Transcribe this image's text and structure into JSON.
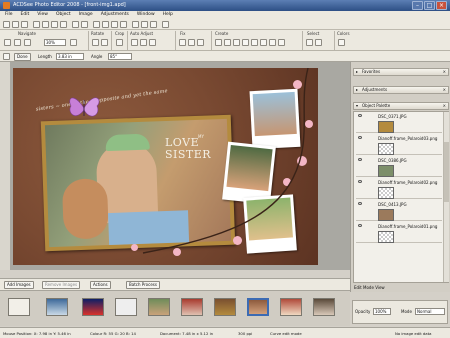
{
  "window": {
    "title": "ACDSee Photo Editor 2008 - [front-img1.apd]",
    "minimize": "–",
    "maximize": "□",
    "close": "×"
  },
  "menu": [
    "File",
    "Edit",
    "View",
    "Object",
    "Image",
    "Adjustments",
    "Window",
    "Help"
  ],
  "groups": {
    "navigate": "Navigate",
    "zoom": "30%",
    "rotate": "Rotate",
    "crop": "Crop",
    "auto_adjust": "Auto Adjust",
    "fix": "Fix",
    "create": "Create",
    "select": "Select",
    "colors": "Colors"
  },
  "options": {
    "done": "Done",
    "length_label": "Length",
    "length_value": "3.83 in",
    "angle_label": "Angle",
    "angle_value": "85°"
  },
  "artwork": {
    "curved_text": "sisters ~ one of the ~ opposite and yet the same",
    "love_title": "LOVE",
    "love_sub": "MY",
    "sister_title": "SISTER"
  },
  "panels": {
    "favorites": "Favorites",
    "adjustments": "Adjustments",
    "object_palette": "Object Palette",
    "layers": [
      {
        "name": "DSC_0371.JPG",
        "thumb": "photo"
      },
      {
        "name": "Dianoff.frame_Polaroid03.png",
        "thumb": "checker"
      },
      {
        "name": "DSC_0386.JPG",
        "thumb": "photo"
      },
      {
        "name": "Dianoff.frame_Polaroid02.png",
        "thumb": "checker"
      },
      {
        "name": "DSC_0413.JPG",
        "thumb": "photo"
      },
      {
        "name": "Dianoff.frame_Polaroid01.png",
        "thumb": "checker"
      }
    ],
    "edit_mode": "Edit Mode View",
    "opacity_label": "Opacity",
    "opacity_value": "100%",
    "mode_label": "Mode",
    "mode_value": "Normal"
  },
  "bottom": {
    "add_images": "Add Images",
    "remove_images": "Remove Images",
    "actions": "Actions",
    "batch_process": "Batch Process"
  },
  "status": {
    "mouse": "Mouse Position:  X: 7.98 in  Y: 5.46 in",
    "colour": "Colour  R: 55  G: 20  B: 14",
    "document": "Document: 7.48 in x 5.12 in",
    "dpi": "300 ppi",
    "mode": "Curve edit mode",
    "edit_info": "No image edit data"
  },
  "colors": {
    "canvas_bg": "#a9a8a2",
    "art_bg": "#7a4a32",
    "title_bar": "#2d4f85",
    "blossom": "#f3b6c5",
    "butterfly": "#c77fd8"
  }
}
